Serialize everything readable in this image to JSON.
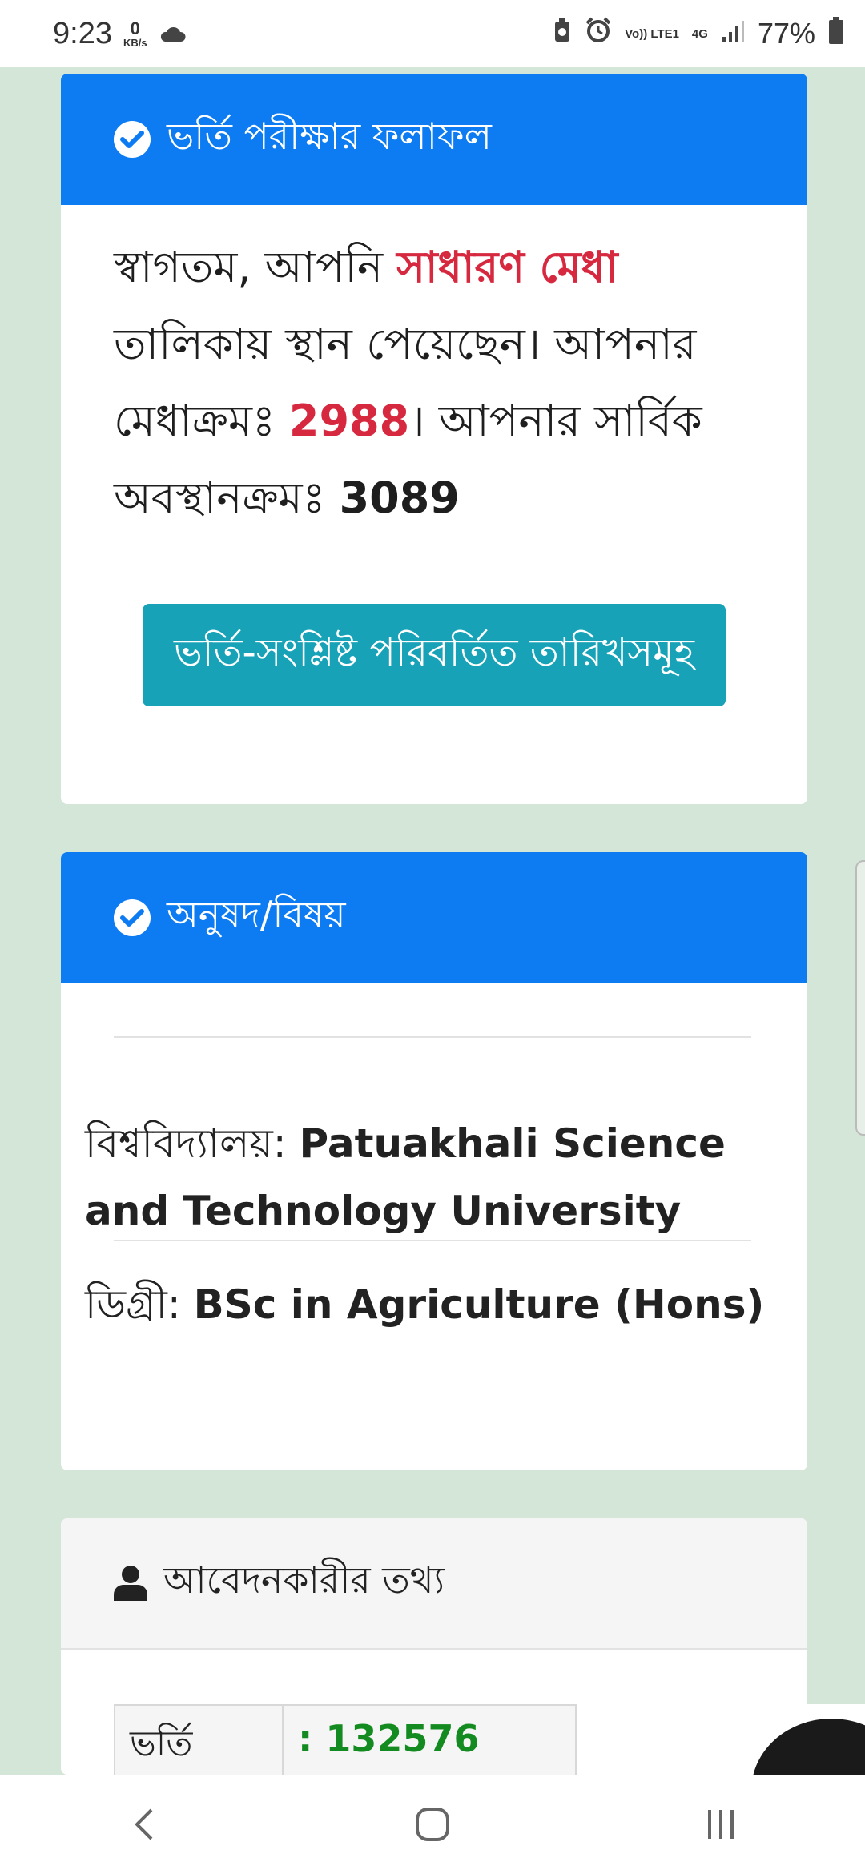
{
  "status_bar": {
    "time": "9:23",
    "net_speed_value": "0",
    "net_speed_unit": "KB/s",
    "volte": "Vo)) LTE1",
    "network": "4G",
    "battery": "77%"
  },
  "result_card": {
    "title": "ভর্তি পরীক্ষার ফলাফল",
    "text_1": "স্বাগতম, আপনি ",
    "list_name": "সাধারণ মেধা",
    "text_2": " তালিকায় স্থান পেয়েছেন। আপনার মেধাক্রমঃ ",
    "merit_rank": "2988",
    "text_3": "। আপনার সার্বিক অবস্থানক্রমঃ ",
    "overall_position": "3089",
    "dates_button": "ভর্তি-সংশ্লিষ্ট পরিবর্তিত তারিখসমূহ"
  },
  "subject_card": {
    "title": "অনুষদ/বিষয়",
    "university_label": "বিশ্ববিদ্যালয়: ",
    "university_value": "Patuakhali Science and Technology University",
    "degree_label": "ডিগ্রী: ",
    "degree_value": "BSc in Agriculture (Hons)"
  },
  "applicant_card": {
    "title": "আবেদনকারীর তথ্য",
    "row_label": "ভর্তি",
    "row_value": ": 132576"
  },
  "colors": {
    "primary": "#0d7cf2",
    "teal": "#17a2b8",
    "highlight_red": "#d6283f",
    "value_green": "#138b20",
    "page_bg": "#d4e6d7"
  }
}
